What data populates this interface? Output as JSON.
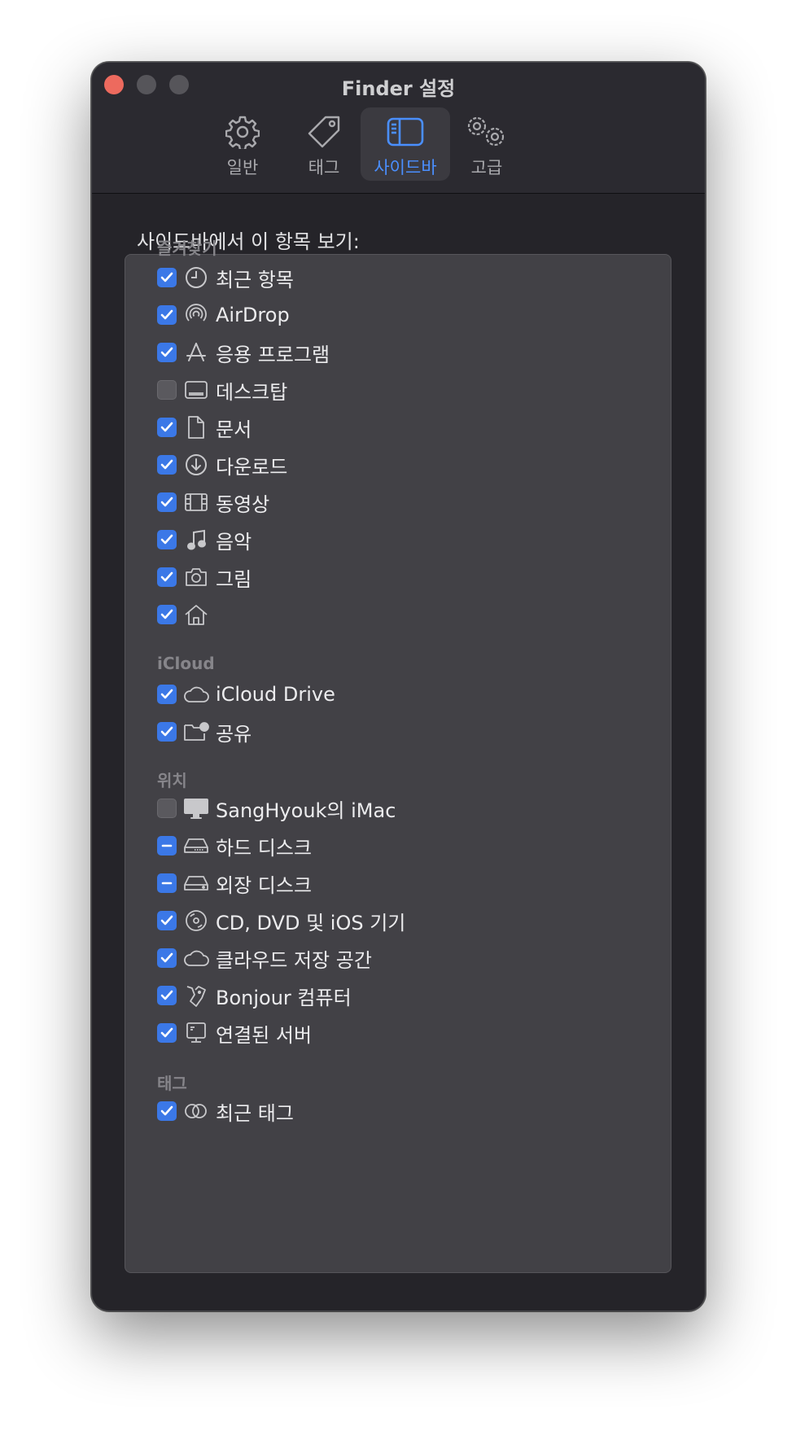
{
  "window": {
    "title": "Finder 설정"
  },
  "tabs": [
    {
      "label": "일반",
      "icon": "gear-icon",
      "active": false
    },
    {
      "label": "태그",
      "icon": "tag-icon",
      "active": false
    },
    {
      "label": "사이드바",
      "icon": "sidebar-icon",
      "active": true
    },
    {
      "label": "고급",
      "icon": "gears-icon",
      "active": false
    }
  ],
  "section_title": "사이드바에서 이 항목 보기:",
  "groups": [
    {
      "header": "즐겨찾기",
      "items": [
        {
          "label": "최근 항목",
          "icon": "clock-icon",
          "state": "checked"
        },
        {
          "label": "AirDrop",
          "icon": "airdrop-icon",
          "state": "checked"
        },
        {
          "label": "응용 프로그램",
          "icon": "applications-icon",
          "state": "checked"
        },
        {
          "label": "데스크탑",
          "icon": "desktop-icon",
          "state": "unchecked"
        },
        {
          "label": "문서",
          "icon": "document-icon",
          "state": "checked"
        },
        {
          "label": "다운로드",
          "icon": "download-icon",
          "state": "checked"
        },
        {
          "label": "동영상",
          "icon": "film-icon",
          "state": "checked"
        },
        {
          "label": "음악",
          "icon": "music-note-icon",
          "state": "checked"
        },
        {
          "label": "그림",
          "icon": "camera-icon",
          "state": "checked"
        },
        {
          "label": "",
          "icon": "home-icon",
          "state": "checked"
        }
      ]
    },
    {
      "header": "iCloud",
      "items": [
        {
          "label": "iCloud Drive",
          "icon": "cloud-icon",
          "state": "checked"
        },
        {
          "label": "공유",
          "icon": "shared-folder-icon",
          "state": "checked"
        }
      ]
    },
    {
      "header": "위치",
      "items": [
        {
          "label": "SangHyouk의 iMac",
          "icon": "imac-icon",
          "state": "unchecked"
        },
        {
          "label": "하드 디스크",
          "icon": "hard-disk-icon",
          "state": "mixed"
        },
        {
          "label": "외장 디스크",
          "icon": "external-disk-icon",
          "state": "mixed"
        },
        {
          "label": "CD, DVD 및 iOS 기기",
          "icon": "disc-icon",
          "state": "checked"
        },
        {
          "label": "클라우드 저장 공간",
          "icon": "cloud-icon",
          "state": "checked"
        },
        {
          "label": "Bonjour 컴퓨터",
          "icon": "bonjour-icon",
          "state": "checked"
        },
        {
          "label": "연결된 서버",
          "icon": "server-icon",
          "state": "checked"
        }
      ]
    },
    {
      "header": "태그",
      "items": [
        {
          "label": "최근 태그",
          "icon": "tags-circles-icon",
          "state": "checked"
        }
      ]
    }
  ],
  "colors": {
    "accent": "#3b78e7",
    "tab_active_text": "#4a8fff",
    "close_button": "#ed6a5e"
  }
}
